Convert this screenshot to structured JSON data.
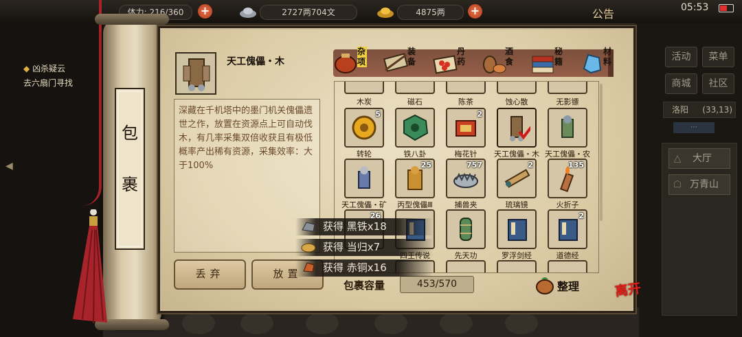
{
  "topbar": {
    "stamina": "体力: 216/360",
    "silver": "2727两704文",
    "gold": "4875两",
    "notice": "公告",
    "time": "05:53"
  },
  "quest": {
    "title": "凶杀疑云",
    "subtitle": "去六扇门寻找"
  },
  "scroll": {
    "title_char_1": "包",
    "title_char_2": "裹"
  },
  "selected_item": {
    "name": "天工傀儡・木",
    "description": "深藏在千机塔中的墨门机关傀儡遗世之作，放置在资源点上可自动伐木，有几率采集双倍收获且有极低概率产出稀有资源，采集效率：大于100%"
  },
  "actions": {
    "discard": "丢弃",
    "place": "放置"
  },
  "tabs": [
    {
      "label": "杂项",
      "icon": "sundries-pot-icon",
      "active": true
    },
    {
      "label": "装备",
      "icon": "equipment-weapons-icon",
      "active": false
    },
    {
      "label": "丹药",
      "icon": "pills-icon",
      "active": false
    },
    {
      "label": "酒食",
      "icon": "wine-food-icon",
      "active": false
    },
    {
      "label": "秘籍",
      "icon": "secret-books-icon",
      "active": false
    },
    {
      "label": "材料",
      "icon": "materials-crystal-icon",
      "active": false
    }
  ],
  "inventory": {
    "row0": [
      {
        "name": "木炭"
      },
      {
        "name": "磁石"
      },
      {
        "name": "陈茶"
      },
      {
        "name": "蚀心散"
      },
      {
        "name": "无影镖"
      }
    ],
    "row1": [
      {
        "name": "转轮",
        "qty": "5"
      },
      {
        "name": "铁八卦",
        "qty": ""
      },
      {
        "name": "梅花针",
        "qty": "2"
      },
      {
        "name": "天工傀儡・木",
        "qty": "",
        "selected": true
      },
      {
        "name": "天工傀儡・农",
        "qty": ""
      }
    ],
    "row2": [
      {
        "name": "天工傀儡・矿",
        "qty": ""
      },
      {
        "name": "丙型傀儡Ⅲ",
        "qty": "25"
      },
      {
        "name": "捕兽夹",
        "qty": "757"
      },
      {
        "name": "琉璃镜",
        "qty": "2"
      },
      {
        "name": "火折子",
        "qty": "135"
      }
    ],
    "row3": [
      {
        "name": "",
        "qty": "26"
      },
      {
        "name": "四王传说",
        "qty": ""
      },
      {
        "name": "先天功",
        "qty": ""
      },
      {
        "name": "罗浮剑经",
        "qty": ""
      },
      {
        "name": "道德经",
        "qty": "2"
      }
    ]
  },
  "capacity": {
    "label": "包裹容量",
    "value": "453/570"
  },
  "sort_label": "整理",
  "toasts": [
    {
      "text": "获得 黑铁x18",
      "icon": "black-iron-icon"
    },
    {
      "text": "获得 当归x7",
      "icon": "angelica-icon"
    },
    {
      "text": "获得 赤铜x16",
      "icon": "red-copper-icon"
    }
  ],
  "leave_label": "离开",
  "right_panel": {
    "buttons": [
      "活动",
      "菜单",
      "商城",
      "社区"
    ],
    "location": "洛阳",
    "coords": "(33,13)",
    "list": [
      "大厅",
      "万青山"
    ]
  },
  "colors": {
    "paper": "#dfd0ac",
    "active_tab": "#f0d040",
    "leave_red": "#e02018",
    "tassel_red": "#a8242a"
  }
}
